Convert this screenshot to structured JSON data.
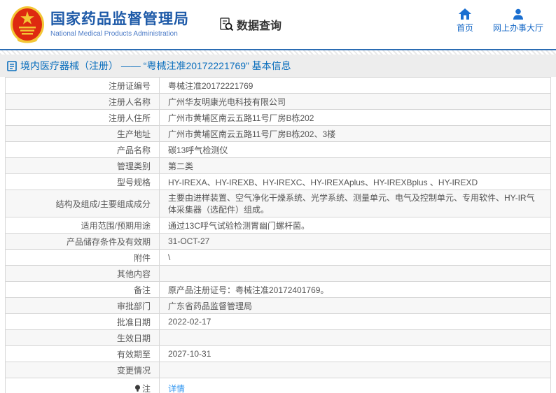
{
  "header": {
    "title": "国家药品监督管理局",
    "subtitle": "National Medical Products Administration",
    "data_query_label": "数据查询",
    "nav": [
      {
        "label": "首页",
        "icon": "home-icon"
      },
      {
        "label": "网上办事大厅",
        "icon": "user-icon"
      }
    ]
  },
  "breadcrumb": {
    "text": "境内医疗器械（注册） —— “粤械注准20172221769” 基本信息"
  },
  "table": {
    "rows": [
      {
        "label": "注册证编号",
        "value": "粤械注准20172221769"
      },
      {
        "label": "注册人名称",
        "value": "广州华友明康光电科技有限公司"
      },
      {
        "label": "注册人住所",
        "value": "广州市黄埔区南云五路11号厂房B栋202"
      },
      {
        "label": "生产地址",
        "value": "广州市黄埔区南云五路11号厂房B栋202、3楼"
      },
      {
        "label": "产品名称",
        "value": "碳13呼气检测仪"
      },
      {
        "label": "管理类别",
        "value": "第二类"
      },
      {
        "label": "型号规格",
        "value": "HY-IREXA、HY-IREXB、HY-IREXC、HY-IREXAplus、HY-IREXBplus 、HY-IREXD"
      },
      {
        "label": "结构及组成/主要组成成分",
        "value": "主要由进样装置、空气净化干燥系统、光学系统、测量单元、电气及控制单元、专用软件、HY-IR气体采集器（选配件）组成。"
      },
      {
        "label": "适用范围/预期用途",
        "value": "通过13C呼气试验检测胃幽门螺杆菌。"
      },
      {
        "label": "产品储存条件及有效期",
        "value": "31-OCT-27"
      },
      {
        "label": "附件",
        "value": "\\"
      },
      {
        "label": "其他内容",
        "value": ""
      },
      {
        "label": "备注",
        "value": "原产品注册证号：粤械注准20172401769。"
      },
      {
        "label": "审批部门",
        "value": "广东省药品监督管理局"
      },
      {
        "label": "批准日期",
        "value": "2022-02-17"
      },
      {
        "label": "生效日期",
        "value": ""
      },
      {
        "label": "有效期至",
        "value": "2027-10-31"
      },
      {
        "label": "变更情况",
        "value": ""
      },
      {
        "label": "注",
        "value": "详情",
        "value_is_link": true,
        "label_icon": "lightbulb-icon",
        "tall": true
      }
    ]
  },
  "colors": {
    "title_blue": "#1e5aa8",
    "subtitle_blue": "#4d7cc7",
    "nav_blue": "#1467c6",
    "divider_blue": "#2b6cb3",
    "breadcrumb_blue": "#0a6ebd",
    "link_blue": "#3598f0",
    "row_alt_bg": "#f7f7f7",
    "border_gray": "#d6d6d6",
    "emblem_red": "#de2910",
    "emblem_gold": "#f3c635"
  }
}
